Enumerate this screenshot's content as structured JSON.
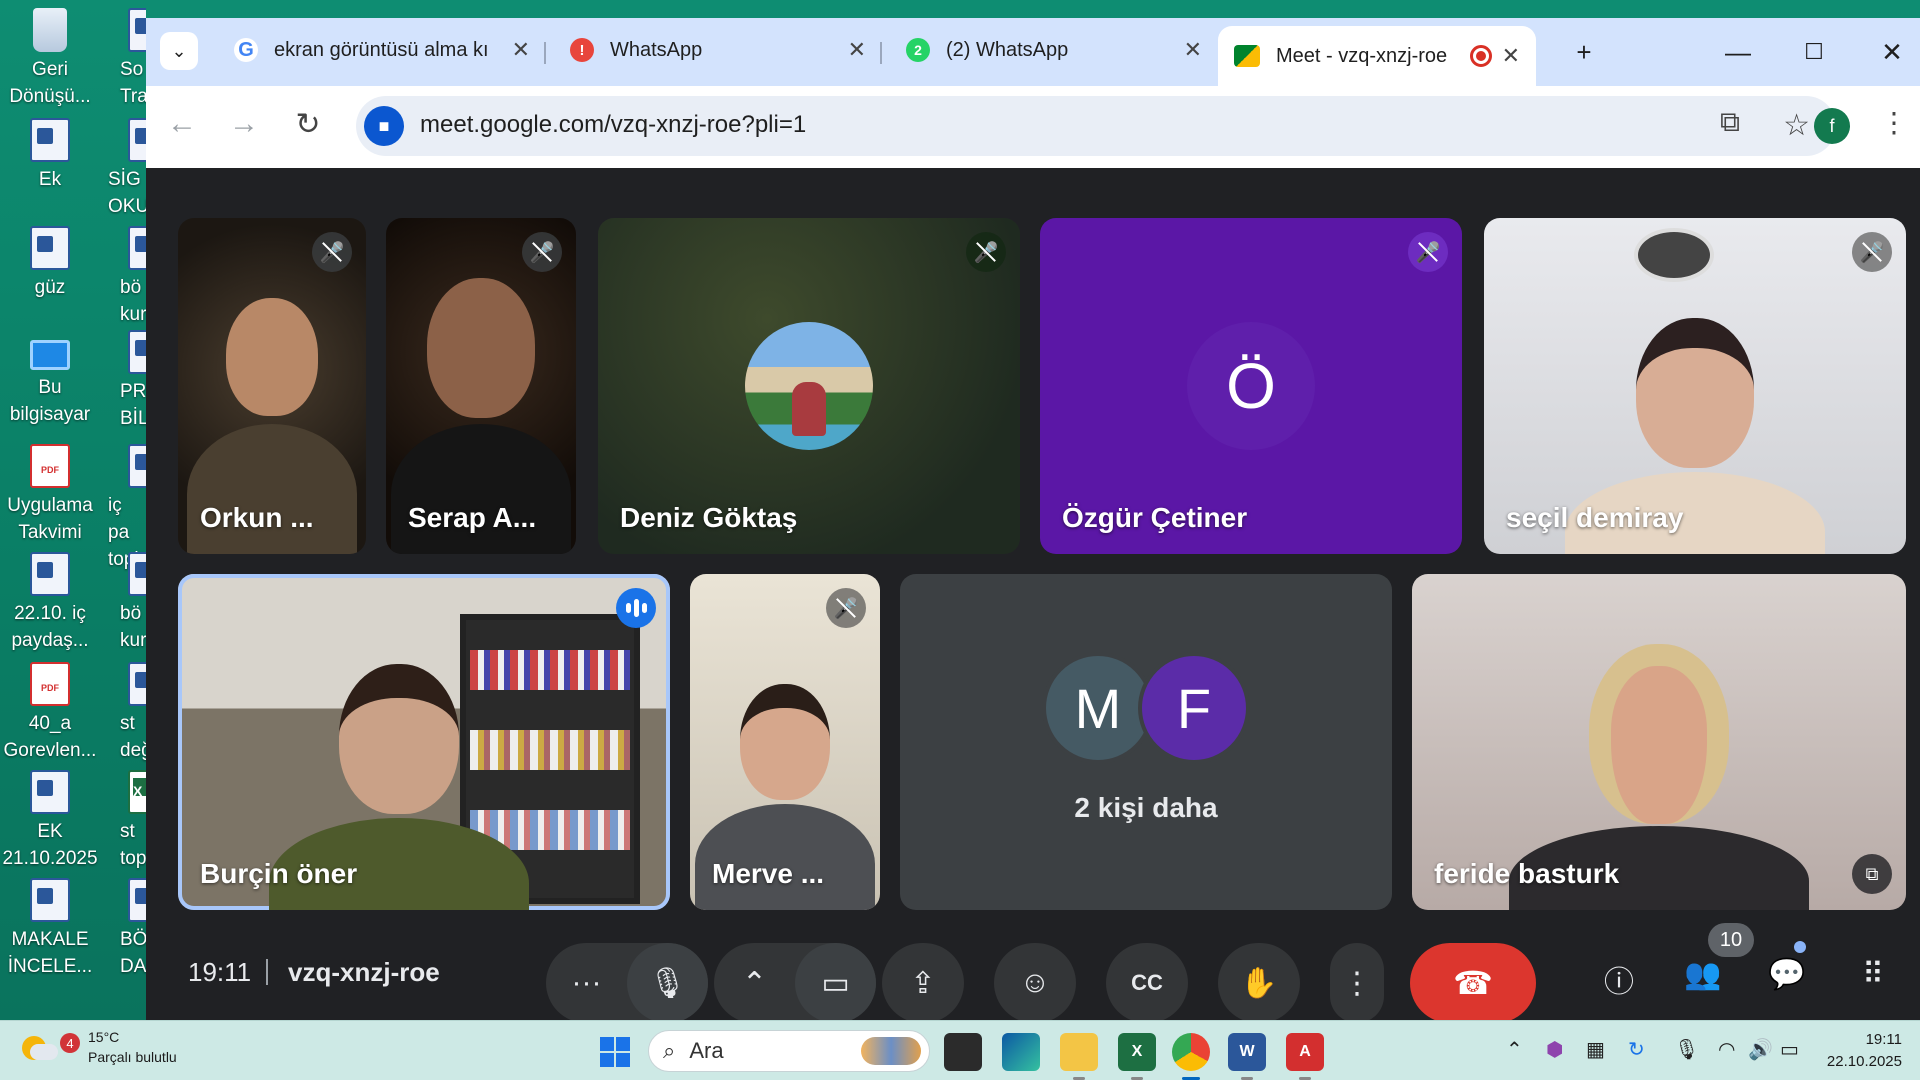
{
  "desktop": {
    "icons": [
      {
        "label": "Geri\nDönüşü...",
        "type": "bin"
      },
      {
        "label": "Ek",
        "type": "doc"
      },
      {
        "label": "güz",
        "type": "doc"
      },
      {
        "label": "Bu\nbilgisayar",
        "type": "pc"
      },
      {
        "label": "Uygulama\nTakvimi",
        "type": "pdf"
      },
      {
        "label": "22.10. iç\npaydaş...",
        "type": "doc"
      },
      {
        "label": "40_a\nGorevlen...",
        "type": "pdf"
      },
      {
        "label": "EK\n21.10.2025",
        "type": "doc"
      },
      {
        "label": "MAKALE\nİNCELE...",
        "type": "doc"
      }
    ],
    "icons_col2": [
      {
        "label": "So\nTran",
        "type": "doc"
      },
      {
        "label": "SİG\nOKU",
        "type": "doc"
      },
      {
        "label": "bö\nkuru",
        "type": "doc"
      },
      {
        "label": "PR\nBİLG",
        "type": "doc"
      },
      {
        "label": "iç pa\ntopla",
        "type": "doc"
      },
      {
        "label": "bö\nkuru",
        "type": "doc"
      },
      {
        "label": "st\ndeğe",
        "type": "doc"
      },
      {
        "label": "st\ntop",
        "type": "xls"
      },
      {
        "label": "BÖ\nDAN",
        "type": "doc"
      }
    ]
  },
  "browser": {
    "tabs": [
      {
        "title": "ekran görüntüsü alma kı",
        "favicon": "G",
        "favicon_color": "#4285f4"
      },
      {
        "title": "WhatsApp",
        "favicon": "!",
        "favicon_color": "#e8453c"
      },
      {
        "title": "(2) WhatsApp",
        "favicon": "2",
        "favicon_color": "#25d366"
      },
      {
        "title": "Meet - vzq-xnzj-roe",
        "favicon": "",
        "favicon_color": "#00832d"
      }
    ],
    "new_tab": "+",
    "url": "meet.google.com/vzq-xnzj-roe?pli=1",
    "profile_initial": "f"
  },
  "meet": {
    "participants": [
      {
        "name": "Orkun ...",
        "muted": true
      },
      {
        "name": "Serap A...",
        "muted": true
      },
      {
        "name": "Deniz Göktaş",
        "muted": true
      },
      {
        "name": "Özgür Çetiner",
        "muted": true,
        "initial": "Ö"
      },
      {
        "name": "seçil demiray",
        "muted": true
      },
      {
        "name": "Burçin öner",
        "muted": false,
        "speaking": true
      },
      {
        "name": "Merve ...",
        "muted": true
      },
      {
        "name": "feride basturk",
        "muted": false
      }
    ],
    "others": {
      "initials": [
        "M",
        "F"
      ],
      "label": "2 kişi daha"
    },
    "time": "19:11",
    "code": "vzq-xnzj-roe",
    "people_count": "10",
    "colors": {
      "hangup": "#dc362e",
      "speaking_border": "#a8c7fa",
      "ozgur_bg": "#5b17a6",
      "others_bg": "#3c4043"
    }
  },
  "taskbar": {
    "weather_temp": "15°C",
    "weather_desc": "Parçalı bulutlu",
    "weather_badge": "4",
    "search_placeholder": "Ara",
    "clock_time": "19:11",
    "clock_date": "22.10.2025"
  }
}
